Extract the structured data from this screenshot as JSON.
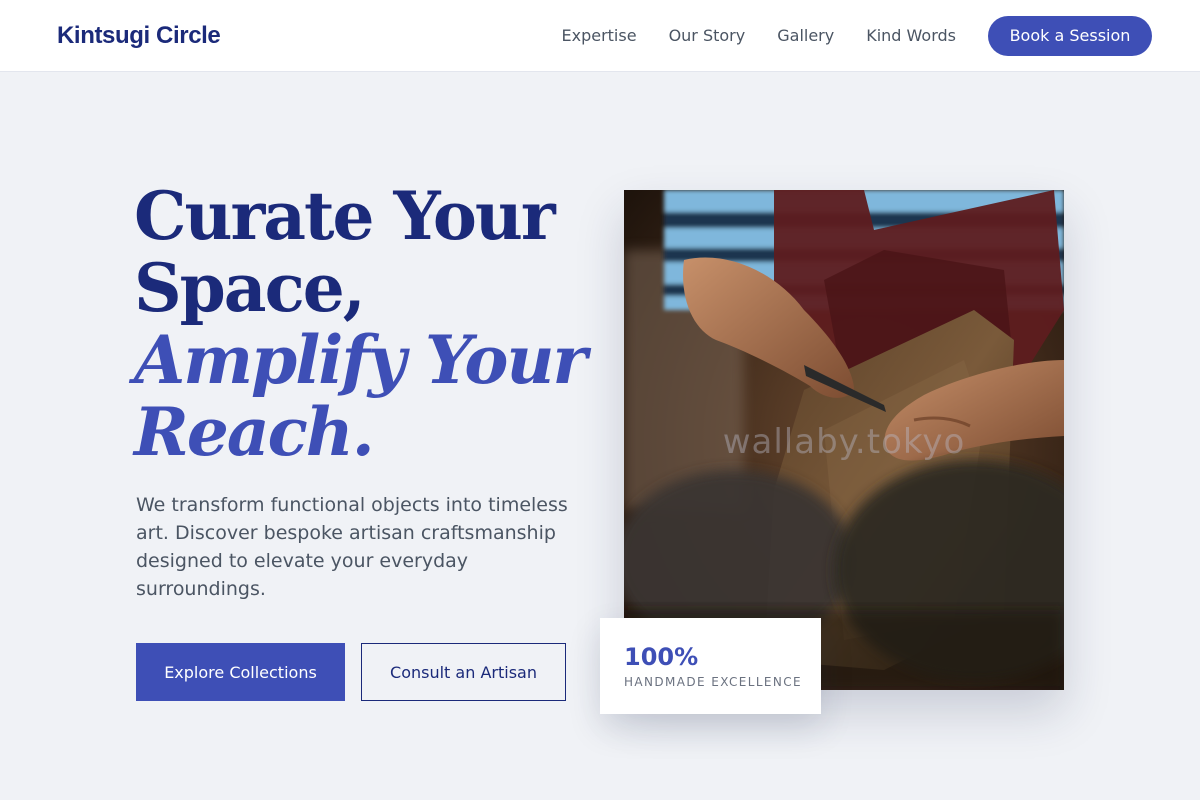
{
  "header": {
    "brand": "Kintsugi Circle",
    "nav": {
      "expertise": "Expertise",
      "our_story": "Our Story",
      "gallery": "Gallery",
      "kind_words": "Kind Words"
    },
    "cta": "Book a Session"
  },
  "hero": {
    "title_line1": "Curate Your",
    "title_line2": "Space,",
    "title_line3": "Amplify Your",
    "title_line4": "Reach.",
    "description": "We transform functional objects into timeless art. Discover bespoke artisan craftsmanship designed to elevate your everyday surroundings.",
    "primary_button": "Explore Collections",
    "secondary_button": "Consult an Artisan",
    "image_watermark": "wallaby.tokyo",
    "stat": {
      "value": "100%",
      "label": "HANDMADE EXCELLENCE"
    }
  },
  "colors": {
    "brand_navy": "#1b2a7a",
    "accent_blue": "#3e4fb6",
    "page_background": "#f0f2f6",
    "body_text": "#4b5563"
  },
  "icons": []
}
